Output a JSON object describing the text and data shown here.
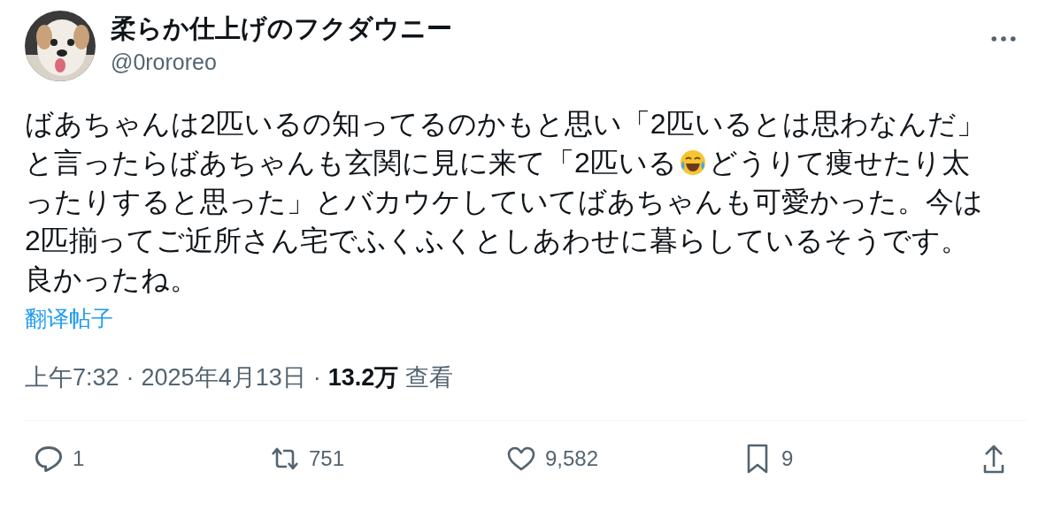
{
  "author": {
    "name": "柔らか仕上げのフクダウニー",
    "handle": "@0rororeo"
  },
  "body": [
    {
      "parts": [
        "ばあちゃんは2匹いるの知ってるのかもと思い「2匹いるとは思わなんだ」"
      ]
    },
    {
      "parts": [
        "と言ったらばあちゃんも玄関に見に来て「2匹いる",
        "どうりて痩せたり太"
      ]
    },
    {
      "parts": [
        "ったりすると思った」とバカウケしていてばあちゃんも可愛かった。今は"
      ]
    },
    {
      "parts": [
        "2匹揃ってご近所さん宅でふくふくとしあわせに暮らしているそうです。"
      ]
    },
    {
      "parts": [
        "良かったね。"
      ]
    }
  ],
  "translate_link": "翻译帖子",
  "meta": {
    "time": "上午7:32",
    "sep1": "·",
    "date": "2025年4月13日",
    "sep2": "·",
    "views": "13.2万",
    "views_label": "查看"
  },
  "actions": [
    {
      "kind": "reply",
      "count": "1"
    },
    {
      "kind": "repost",
      "count": "751"
    },
    {
      "kind": "like",
      "count": "9,582"
    },
    {
      "kind": "bookmark",
      "count": "9"
    },
    {
      "kind": "share"
    }
  ]
}
